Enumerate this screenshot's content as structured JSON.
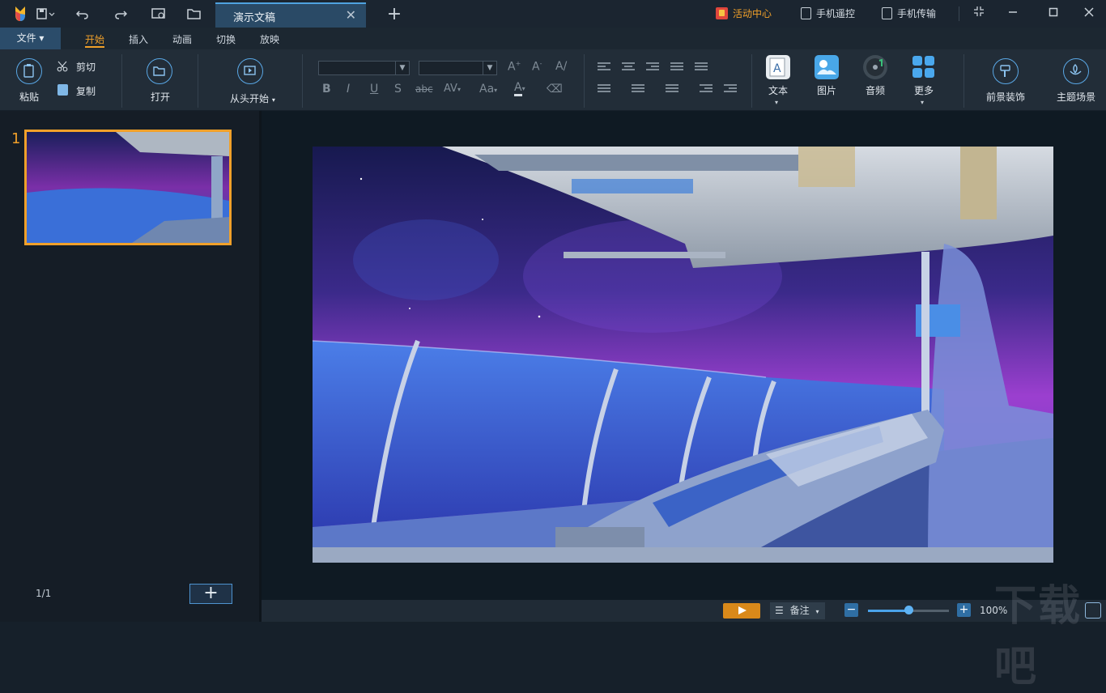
{
  "titlebar": {
    "active_tab": "演示文稿",
    "new_tab": "+",
    "activity_center": "活动中心",
    "phone_remote": "手机遥控",
    "phone_transfer": "手机传输"
  },
  "menubar": {
    "file": "文件",
    "tabs": [
      "开始",
      "插入",
      "动画",
      "切换",
      "放映"
    ],
    "active_tab": "开始"
  },
  "ribbon": {
    "paste": "粘贴",
    "cut": "剪切",
    "copy": "复制",
    "open": "打开",
    "from_start": "从头开始",
    "insert_text": "文本",
    "insert_image": "图片",
    "insert_audio": "音频",
    "more": "更多",
    "foreground_decor": "前景装饰",
    "theme_scene": "主题场景",
    "format_buttons": [
      "B",
      "I",
      "U",
      "S",
      "abc",
      "AV",
      "Aa",
      "A"
    ]
  },
  "slides": {
    "current_number": "1",
    "page_count": "1/1",
    "add_label": "+"
  },
  "statusbar": {
    "notes": "备注",
    "zoom": "100%"
  },
  "watermark": "下载吧",
  "colors": {
    "accent_orange": "#f0a02a",
    "accent_blue": "#4fa3e0",
    "background": "#16202a"
  },
  "zoom_slider_fraction": 0.5
}
